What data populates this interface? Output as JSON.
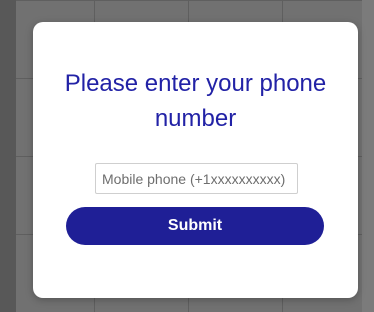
{
  "dialog": {
    "title": "Please enter your phone number",
    "phone_input": {
      "placeholder": "Mobile phone (+1xxxxxxxxxx)",
      "value": ""
    },
    "submit_label": "Submit"
  },
  "colors": {
    "title_text": "#2222a6",
    "button_background": "#1f1f96",
    "button_text": "#ffffff",
    "modal_background": "#ffffff",
    "overlay": "#717171"
  }
}
